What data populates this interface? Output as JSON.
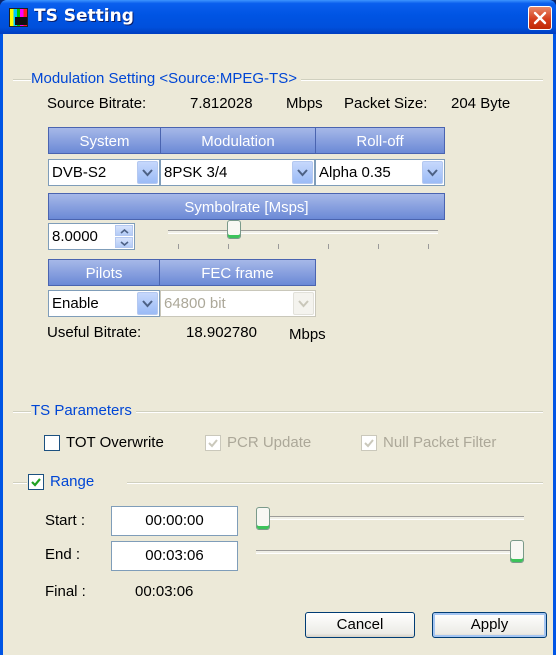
{
  "window": {
    "title": "TS Setting"
  },
  "modulation": {
    "group_title": "Modulation Setting <Source:MPEG-TS>",
    "source_bitrate_label": "Source Bitrate:",
    "source_bitrate_value": "7.812028",
    "source_bitrate_unit": "Mbps",
    "packet_size_label": "Packet Size:",
    "packet_size_value": "204 Byte",
    "headers": {
      "system": "System",
      "modulation": "Modulation",
      "rolloff": "Roll-off"
    },
    "system_value": "DVB-S2",
    "modulation_value": "8PSK 3/4",
    "rolloff_value": "Alpha 0.35",
    "symbolrate_header": "Symbolrate [Msps]",
    "symbolrate_value": "8.0000",
    "symbolrate_slider_fraction": 0.23,
    "pilots_header": "Pilots",
    "fec_header": "FEC frame",
    "pilots_value": "Enable",
    "fec_value": "64800 bit",
    "useful_bitrate_label": "Useful Bitrate:",
    "useful_bitrate_value": "18.902780",
    "useful_bitrate_unit": "Mbps"
  },
  "ts_params": {
    "group_title": "TS Parameters",
    "tot_overwrite": {
      "label": "TOT Overwrite",
      "checked": false,
      "enabled": true
    },
    "pcr_update": {
      "label": "PCR Update",
      "checked": true,
      "enabled": false
    },
    "null_packet_filter": {
      "label": "Null Packet Filter",
      "checked": true,
      "enabled": false
    }
  },
  "range": {
    "label": "Range",
    "checked": true,
    "start_label": "Start :",
    "start_value": "00:00:00",
    "start_slider_fraction": 0.0,
    "end_label": "End :",
    "end_value": "00:03:06",
    "end_slider_fraction": 1.0,
    "final_label": "Final :",
    "final_value": "00:03:06"
  },
  "buttons": {
    "cancel": "Cancel",
    "apply": "Apply"
  },
  "colors": {
    "titlebar": "#0054e3",
    "group_title": "#0046d5",
    "dialog_bg": "#ece9d8",
    "header_bg": "#7b96db"
  }
}
